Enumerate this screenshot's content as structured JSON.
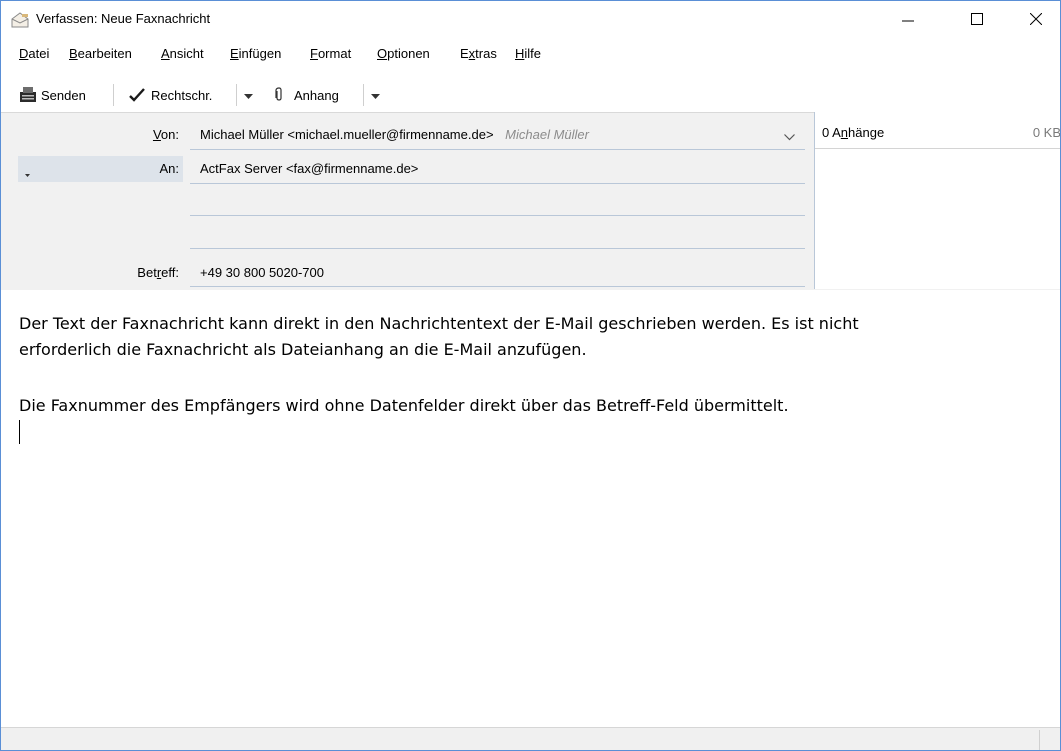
{
  "window": {
    "title": "Verfassen: Neue Faxnachricht",
    "controls": {
      "minimize": "—",
      "maximize": "☐",
      "close": "✕"
    }
  },
  "menu": [
    {
      "pre": "",
      "acc": "D",
      "post": "atei"
    },
    {
      "pre": "",
      "acc": "B",
      "post": "earbeiten"
    },
    {
      "pre": "",
      "acc": "A",
      "post": "nsicht"
    },
    {
      "pre": "",
      "acc": "E",
      "post": "infügen"
    },
    {
      "pre": "",
      "acc": "F",
      "post": "ormat"
    },
    {
      "pre": "",
      "acc": "O",
      "post": "ptionen"
    },
    {
      "pre": "E",
      "acc": "x",
      "post": "tras"
    },
    {
      "pre": "",
      "acc": "H",
      "post": "ilfe"
    }
  ],
  "toolbar": {
    "send_label": "Senden",
    "spell_label": "Rechtschr.",
    "attach_label": "Anhang"
  },
  "header": {
    "from": {
      "label_acc": "V",
      "label_rest": "on:",
      "address": "Michael Müller <michael.mueller@firmenname.de>",
      "identity": "Michael Müller"
    },
    "to": {
      "label": "An:",
      "address": "ActFax Server <fax@firmenname.de>"
    },
    "subject": {
      "label_pre": "Bet",
      "label_acc": "r",
      "label_rest": "eff:",
      "value": "+49 30 800 5020-700"
    }
  },
  "attachments": {
    "count_pre": "0 A",
    "count_acc": "n",
    "count_rest": "hänge",
    "size": "0 KB"
  },
  "message": {
    "line1": "Der Text der Faxnachricht kann direkt in den Nachrichtentext der E-Mail geschrieben werden. Es ist nicht",
    "line2": "erforderlich die Faxnachricht als Dateianhang an die E-Mail anzufügen.",
    "line3": "Die Faxnummer des Empfängers wird ohne Datenfelder direkt über das Betreff-Feld übermittelt."
  }
}
